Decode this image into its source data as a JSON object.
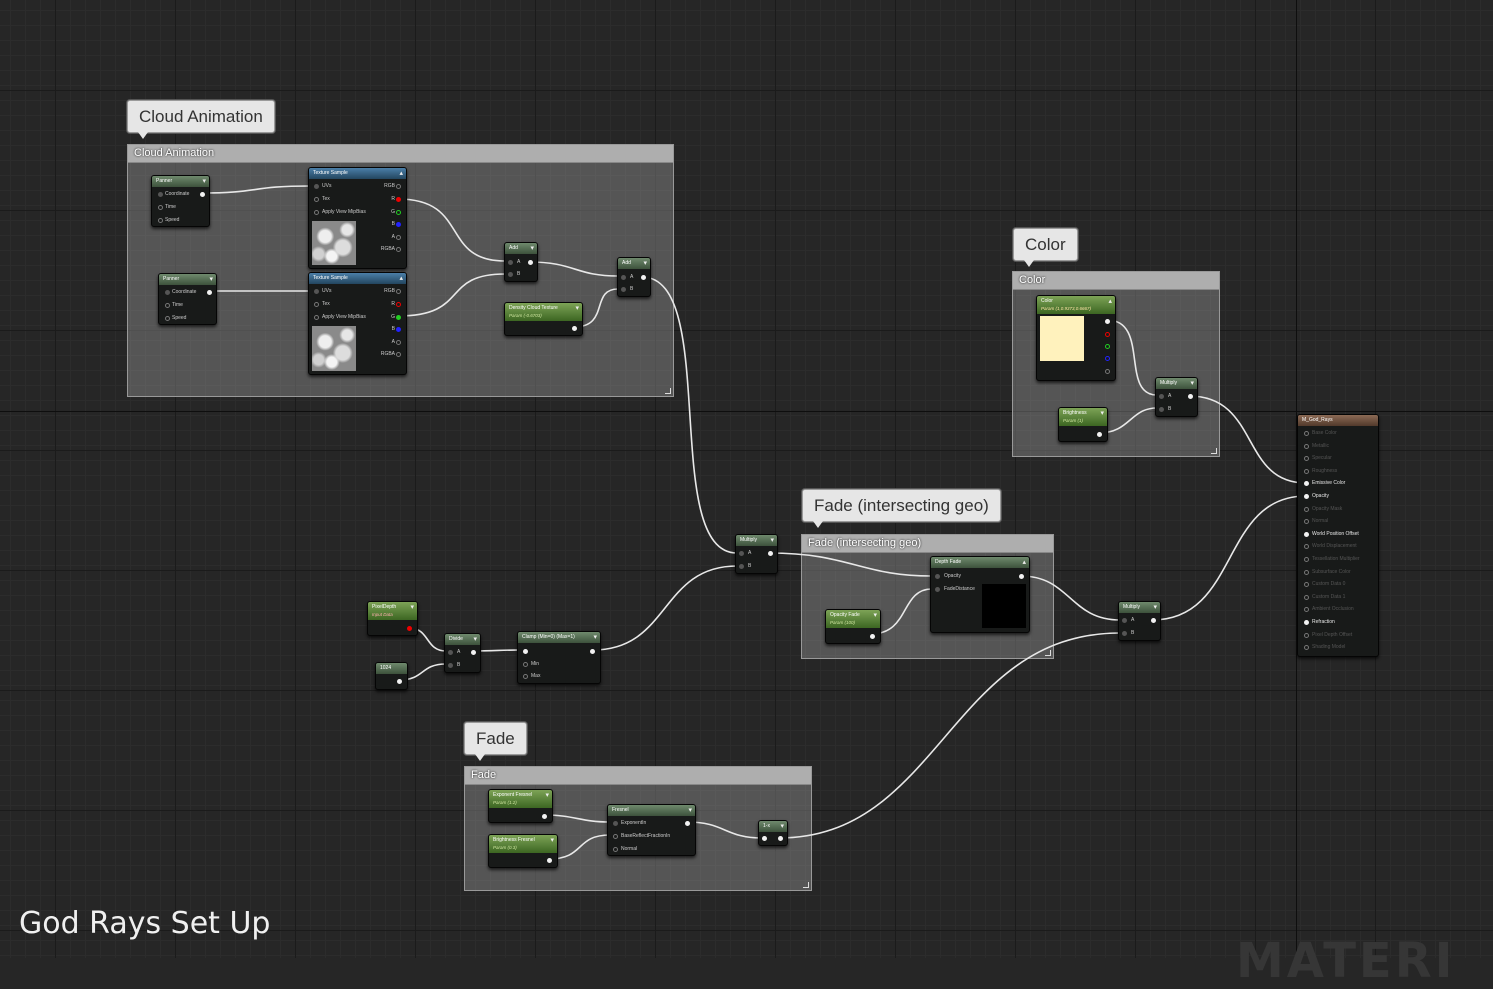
{
  "page": {
    "title": "God Rays Set Up",
    "watermark": "MATERI"
  },
  "comments": {
    "cloud": {
      "bubble": "Cloud Animation",
      "title": "Cloud Animation"
    },
    "color": {
      "bubble": "Color",
      "title": "Color"
    },
    "fade_geo": {
      "bubble": "Fade (intersecting geo)",
      "title": "Fade (intersecting geo)"
    },
    "fade": {
      "bubble": "Fade",
      "title": "Fade"
    }
  },
  "nodes": {
    "panner1": {
      "title": "Panner",
      "pins": [
        "Coordinate",
        "Time",
        "Speed"
      ]
    },
    "panner2": {
      "title": "Panner",
      "pins": [
        "Coordinate",
        "Time",
        "Speed"
      ]
    },
    "tex1": {
      "title": "Texture Sample",
      "inputs": [
        "UVs",
        "Tex",
        "Apply View MipBias"
      ],
      "outputs": [
        "RGB",
        "R",
        "G",
        "B",
        "A",
        "RGBA"
      ]
    },
    "tex2": {
      "title": "Texture Sample",
      "inputs": [
        "UVs",
        "Tex",
        "Apply View MipBias"
      ],
      "outputs": [
        "RGB",
        "R",
        "G",
        "B",
        "A",
        "RGBA"
      ]
    },
    "add1": {
      "title": "Add",
      "pins": [
        "A",
        "B"
      ]
    },
    "add2": {
      "title": "Add",
      "pins": [
        "A",
        "B"
      ]
    },
    "density": {
      "title": "Density Cloud Texture",
      "sub": "Param (-0.6703)"
    },
    "color_param": {
      "title": "Color",
      "sub": "Param (1,0.9373,0.6667)",
      "swatch": "#fff2bd"
    },
    "multiply_color": {
      "title": "Multiply",
      "pins": [
        "A",
        "B"
      ]
    },
    "brightness": {
      "title": "Brightness",
      "sub": "Param (1)"
    },
    "multiply_main": {
      "title": "Multiply",
      "pins": [
        "A",
        "B"
      ]
    },
    "depth_fade": {
      "title": "Depth Fade",
      "pins": [
        "Opacity",
        "FadeDistance"
      ]
    },
    "opacity_fade": {
      "title": "Opacity Fade",
      "sub": "Param (100)"
    },
    "pixel_depth": {
      "title": "PixelDepth",
      "sub": "Input Data"
    },
    "const_1024": {
      "title": "1024"
    },
    "divide": {
      "title": "Divide",
      "pins": [
        "A",
        "B"
      ]
    },
    "clamp": {
      "title": "Clamp (Min=0) (Max=1)",
      "pins": [
        "Min",
        "Max"
      ]
    },
    "multiply_final": {
      "title": "Multiply",
      "pins": [
        "A",
        "B"
      ]
    },
    "exp_fresnel": {
      "title": "Exponent Fresnel",
      "sub": "Param (1.2)"
    },
    "bright_fresnel": {
      "title": "Brightness Fresnel",
      "sub": "Param (0.3)"
    },
    "fresnel": {
      "title": "Fresnel",
      "pins": [
        "ExponentIn",
        "BaseReflectFractionIn",
        "Normal"
      ]
    },
    "one_minus": {
      "title": "1-x"
    },
    "material": {
      "title": "M_God_Rays",
      "pins": [
        {
          "label": "Base Color",
          "active": false
        },
        {
          "label": "Metallic",
          "active": false
        },
        {
          "label": "Specular",
          "active": false
        },
        {
          "label": "Roughness",
          "active": false
        },
        {
          "label": "Emissive Color",
          "active": true
        },
        {
          "label": "Opacity",
          "active": true
        },
        {
          "label": "Opacity Mask",
          "active": false
        },
        {
          "label": "Normal",
          "active": false
        },
        {
          "label": "World Position Offset",
          "active": true
        },
        {
          "label": "World Displacement",
          "active": false
        },
        {
          "label": "Tessellation Multiplier",
          "active": false
        },
        {
          "label": "Subsurface Color",
          "active": false
        },
        {
          "label": "Custom Data 0",
          "active": false
        },
        {
          "label": "Custom Data 1",
          "active": false
        },
        {
          "label": "Ambient Occlusion",
          "active": false
        },
        {
          "label": "Refraction",
          "active": true
        },
        {
          "label": "Pixel Depth Offset",
          "active": false
        },
        {
          "label": "Shading Model",
          "active": false
        }
      ]
    }
  },
  "colors": {
    "wire": "#e8e8e8",
    "accent_param": "#7da356",
    "comment": "#8a8a8a"
  }
}
